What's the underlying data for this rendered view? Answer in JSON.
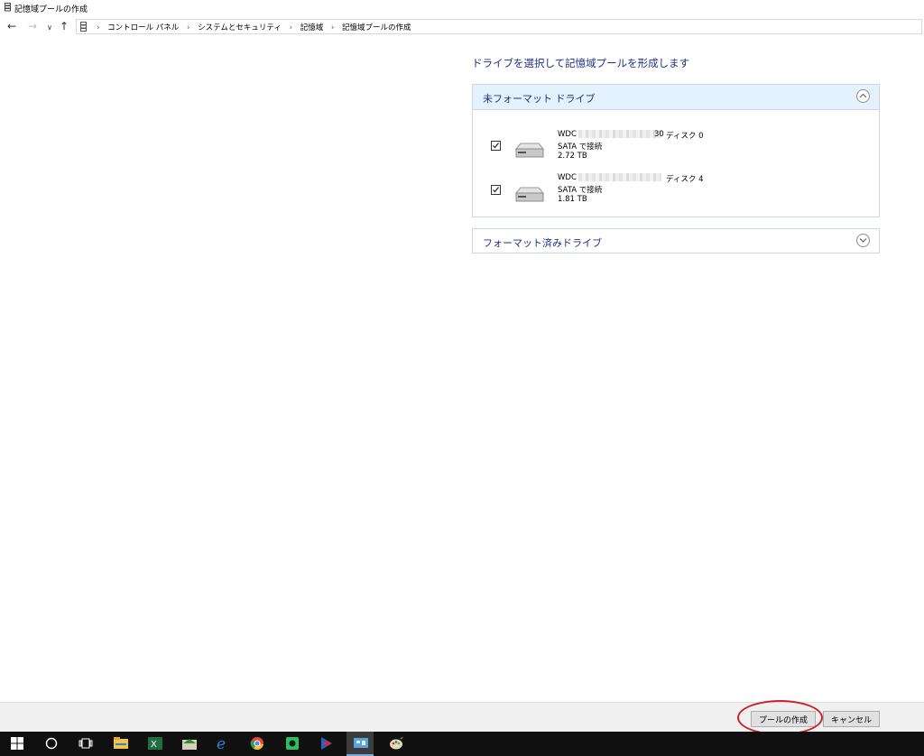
{
  "window": {
    "title": "記憶域プールの作成"
  },
  "nav": {
    "back_icon": "back-arrow-icon",
    "forward_icon": "forward-arrow-icon",
    "recent_icon": "chevron-down-icon",
    "up_icon": "up-arrow-icon",
    "breadcrumbs": [
      "コントロール パネル",
      "システムとセキュリティ",
      "記憶域",
      "記憶域プールの作成"
    ]
  },
  "main": {
    "heading": "ドライブを選択して記憶域プールを形成します",
    "unformatted_group": {
      "title": "未フォーマット ドライブ",
      "expanded": true,
      "drives": [
        {
          "name_prefix": "WDC \\",
          "name_suffix": "30",
          "disk_label": "ディスク 0",
          "connection": "SATA で接続",
          "size": "2.72 TB",
          "checked": true
        },
        {
          "name_prefix": "WDC \\",
          "name_suffix": "",
          "disk_label": "ディスク 4",
          "connection": "SATA で接続",
          "size": "1.81 TB",
          "checked": true
        }
      ]
    },
    "formatted_group": {
      "title": "フォーマット済みドライブ",
      "expanded": false
    }
  },
  "footer": {
    "create_pool_label": "プールの作成",
    "cancel_label": "キャンセル"
  },
  "colors": {
    "accent_text": "#1e3287",
    "header_bg": "#e3f2fc",
    "highlight": "#d0202d"
  },
  "taskbar": {
    "items": [
      "windows-start-icon",
      "cortana-search-icon",
      "task-view-icon",
      "file-explorer-icon",
      "excel-icon",
      "mail-app-icon",
      "edge-icon",
      "chrome-icon",
      "evernote-icon",
      "media-app-icon",
      "control-panel-icon",
      "paint-icon"
    ]
  }
}
